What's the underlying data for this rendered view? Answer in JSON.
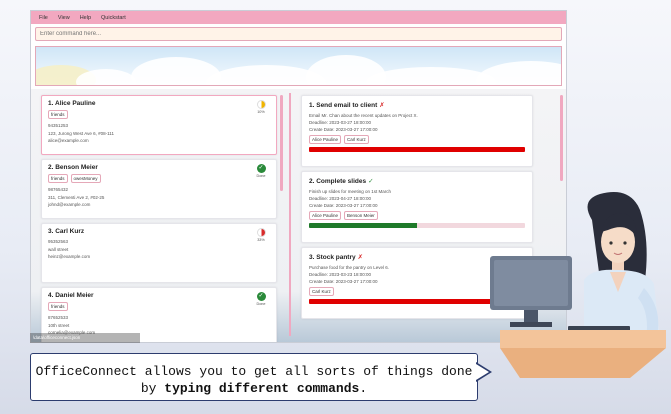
{
  "menu": {
    "file": "File",
    "view": "View",
    "help": "Help",
    "quickstart": "Quickstart"
  },
  "command": {
    "placeholder": "Enter command here..."
  },
  "persons": [
    {
      "index": "1.",
      "name": "Alice Pauline",
      "tags": [
        "friends"
      ],
      "phone": "94351253",
      "address": "123, Jurong West Ave 6, #08-111",
      "email": "alice@example.com",
      "status": "10%",
      "status_color": "#f0b400",
      "status_kind": "partial"
    },
    {
      "index": "2.",
      "name": "Benson Meier",
      "tags": [
        "friends",
        "owesMoney"
      ],
      "phone": "98765432",
      "address": "311, Clementi Ave 2, #02-25",
      "email": "johnd@example.com",
      "status": "Done",
      "status_color": "#2a8a3a",
      "status_kind": "done"
    },
    {
      "index": "3.",
      "name": "Carl Kurz",
      "tags": [],
      "phone": "95352563",
      "address": "wall street",
      "email": "heinz@example.com",
      "status": "33%",
      "status_color": "#d82b2b",
      "status_kind": "partial"
    },
    {
      "index": "4.",
      "name": "Daniel Meier",
      "tags": [
        "friends"
      ],
      "phone": "87652533",
      "address": "10th street",
      "email": "cornelia@example.com",
      "status": "Done",
      "status_color": "#2a8a3a",
      "status_kind": "done"
    }
  ],
  "tasks": [
    {
      "index": "1.",
      "name": "Send email to client",
      "status": "✗",
      "status_kind": "x",
      "desc": "Email Mr. Chan about the recent updates on Project X.",
      "deadline": "Deadline: 2023-03-27 18:00:00",
      "created": "Create Date: 2023-03-27 17:00:00",
      "assignees": [
        "Alice Pauline",
        "Carl Kurz"
      ],
      "progress": 1.0,
      "bar_color": "red"
    },
    {
      "index": "2.",
      "name": "Complete slides",
      "status": "✓",
      "status_kind": "v",
      "desc": "Finish up slides for meeting on 1st March",
      "deadline": "Deadline: 2023-04-27 18:00:00",
      "created": "Create Date: 2023-03-27 17:00:00",
      "assignees": [
        "Alice Pauline",
        "Benson Meier"
      ],
      "progress": 0.5,
      "bar_color": "green"
    },
    {
      "index": "3.",
      "name": "Stock pantry",
      "status": "✗",
      "status_kind": "x",
      "desc": "Purchase food for the pantry on Level 6.",
      "deadline": "Deadline: 2023-03-23 18:00:00",
      "created": "Create Date: 2023-03-27 17:00:00",
      "assignees": [
        "Carl Kurz"
      ],
      "progress": 1.0,
      "bar_color": "red"
    }
  ],
  "app_status": "\\data\\officeconnect.json",
  "caption": {
    "line1": "OfficeConnect allows you to get all sorts of things done",
    "line2_pre": "by ",
    "line2_bold": "typing different commands",
    "line2_post": "."
  }
}
